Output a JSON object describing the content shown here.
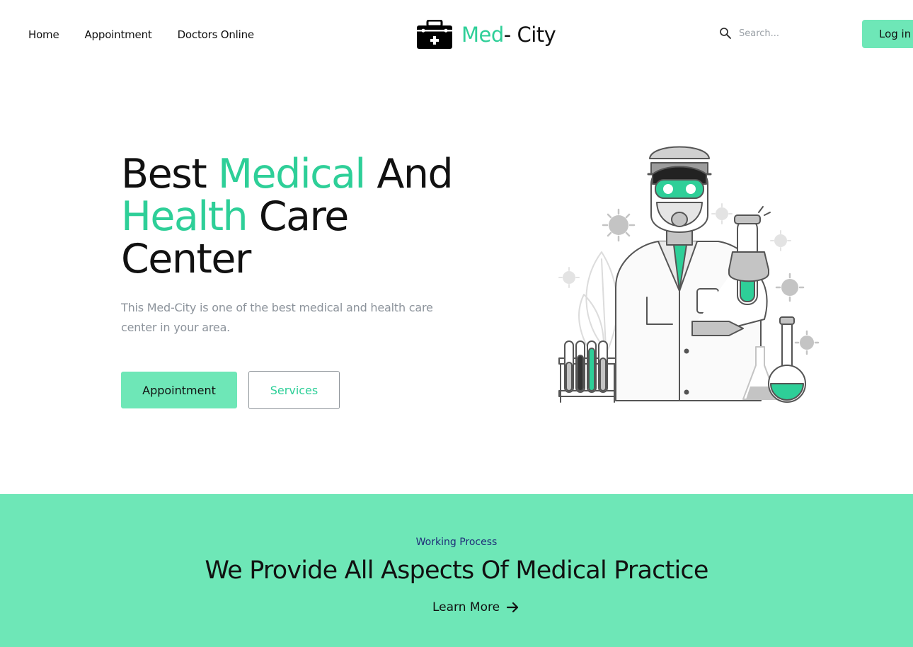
{
  "nav": {
    "links": [
      "Home",
      "Appointment",
      "Doctors Online"
    ],
    "logo_part1": "Med",
    "logo_part2": "- City",
    "search_placeholder": "Search...",
    "login_label": "Log in"
  },
  "hero": {
    "title_w1": "Best ",
    "title_w2": "Medical",
    "title_w3": " And ",
    "title_w4": "Health",
    "title_w5": " Care Center",
    "description": "This Med-City is one of the best medical and health care center in your area.",
    "btn_appointment": "Appointment",
    "btn_services": "Services"
  },
  "process": {
    "eyebrow": "Working Process",
    "title": "We Provide All Aspects Of Medical Practice",
    "learn_more": "Learn More"
  },
  "colors": {
    "accent": "#2ecf98",
    "button_bg": "#6ee7b7",
    "eyebrow": "#1f2d78",
    "muted_text": "#8c939b"
  },
  "icons": {
    "logo": "medical-kit-icon",
    "search": "search-icon",
    "learn_more": "arrow-right-icon",
    "illustration": "scientist-illustration"
  }
}
